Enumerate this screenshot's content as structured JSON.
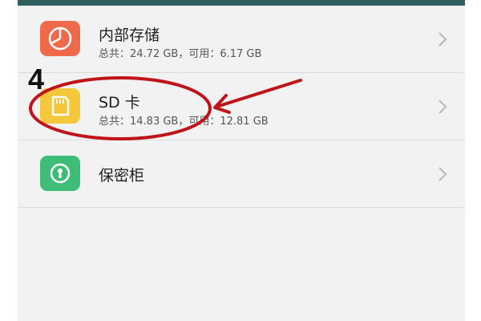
{
  "storage": {
    "items": [
      {
        "label": "内部存储",
        "subtitle": "总共：24.72 GB，可用：6.17 GB",
        "icon": "pie-chart-icon",
        "color": "#ef6a4a"
      },
      {
        "label": "SD 卡",
        "subtitle": "总共：14.83 GB，可用：12.81 GB",
        "icon": "sd-card-icon",
        "color": "#f5c73a"
      },
      {
        "label": "保密柜",
        "icon": "lock-safe-icon",
        "color": "#3dbd78"
      }
    ]
  },
  "annotation": {
    "step_number": "4",
    "color": "#c0141b"
  },
  "colors": {
    "top_bar": "#2f5f5e",
    "background": "#f2f2f2"
  }
}
